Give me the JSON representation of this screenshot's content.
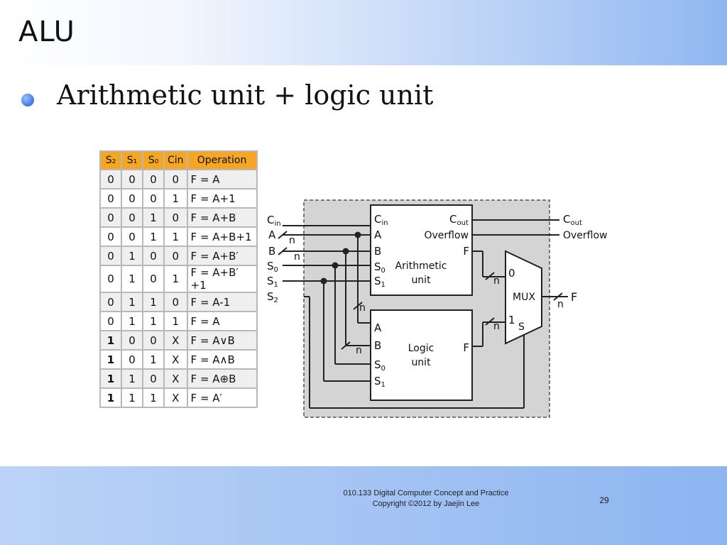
{
  "slide": {
    "title": "ALU",
    "bullet": "Arithmetic unit + logic unit",
    "footer_line1": "010.133 Digital Computer Concept and Practice",
    "footer_line2": "Copyright ©2012 by Jaejin Lee",
    "page_number": "29"
  },
  "table": {
    "headers": [
      "S₂",
      "S₁",
      "S₀",
      "Cin",
      "Operation"
    ],
    "rows": [
      [
        "0",
        "0",
        "0",
        "0",
        "F = A"
      ],
      [
        "0",
        "0",
        "0",
        "1",
        "F = A+1"
      ],
      [
        "0",
        "0",
        "1",
        "0",
        "F = A+B"
      ],
      [
        "0",
        "0",
        "1",
        "1",
        "F = A+B+1"
      ],
      [
        "0",
        "1",
        "0",
        "0",
        "F = A+B′"
      ],
      [
        "0",
        "1",
        "0",
        "1",
        "F = A+B′+1"
      ],
      [
        "0",
        "1",
        "1",
        "0",
        "F = A-1"
      ],
      [
        "0",
        "1",
        "1",
        "1",
        "F = A"
      ],
      [
        "1",
        "0",
        "0",
        "X",
        "F = A∨B"
      ],
      [
        "1",
        "0",
        "1",
        "X",
        "F = A∧B"
      ],
      [
        "1",
        "1",
        "0",
        "X",
        "F = A⊕B"
      ],
      [
        "1",
        "1",
        "1",
        "X",
        "F = A′"
      ]
    ]
  },
  "diagram": {
    "inputs": {
      "cin": "C",
      "cin_sub": "in",
      "a": "A",
      "b": "B",
      "s0": "S",
      "s0_sub": "0",
      "s1": "S",
      "s1_sub": "1",
      "s2": "S",
      "s2_sub": "2"
    },
    "outputs": {
      "cout": "C",
      "cout_sub": "out",
      "overflow": "Overflow",
      "f": "F"
    },
    "arith": {
      "cin": "C",
      "cin_sub": "in",
      "a": "A",
      "b": "B",
      "s0": "S",
      "s0_sub": "0",
      "s1": "S",
      "s1_sub": "1",
      "cout": "C",
      "cout_sub": "out",
      "overflow": "Overflow",
      "f": "F",
      "name1": "Arithmetic",
      "name2": "unit"
    },
    "logic": {
      "a": "A",
      "b": "B",
      "s0": "S",
      "s0_sub": "0",
      "s1": "S",
      "s1_sub": "1",
      "f": "F",
      "name1": "Logic",
      "name2": "unit"
    },
    "mux": {
      "name": "MUX",
      "in0": "0",
      "in1": "1",
      "sel": "S"
    },
    "bus_width": "n"
  }
}
